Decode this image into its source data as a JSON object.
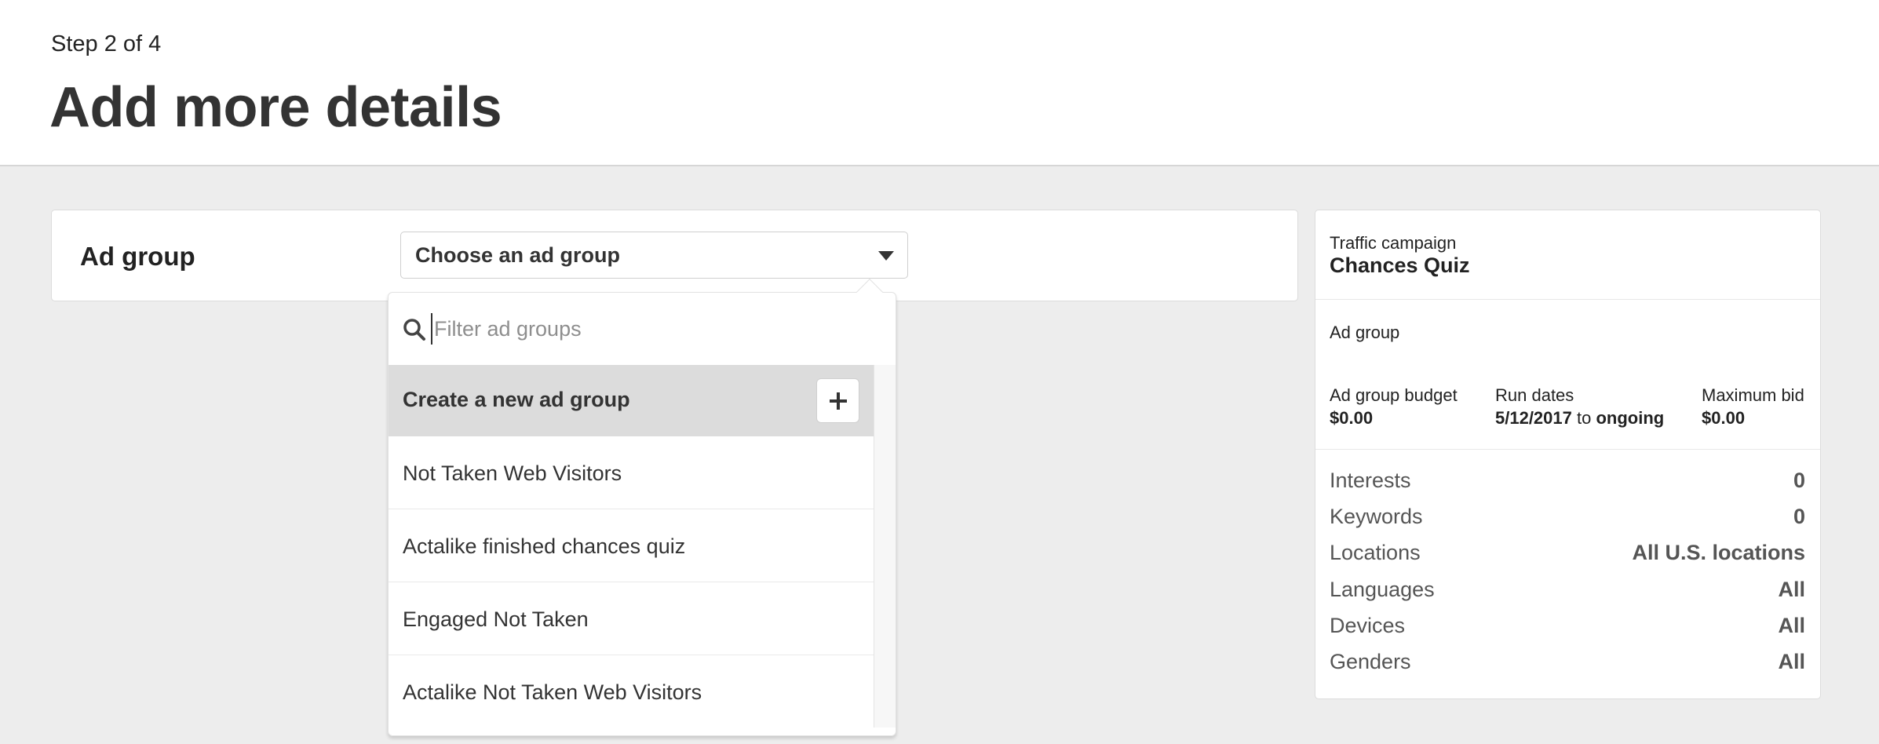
{
  "header": {
    "step": "Step 2 of 4",
    "title": "Add more details"
  },
  "ad_group_field": {
    "label": "Ad group",
    "select_value": "Choose an ad group",
    "caret_icon": "caret-down-icon"
  },
  "dropdown": {
    "filter_placeholder": "Filter ad groups",
    "filter_value": "",
    "search_icon": "search-icon",
    "create_label": "Create a new ad group",
    "create_icon": "plus-icon",
    "items": [
      {
        "label": "Not Taken Web Visitors"
      },
      {
        "label": "Actalike finished chances quiz"
      },
      {
        "label": "Engaged Not Taken"
      },
      {
        "label": "Actalike Not Taken Web Visitors"
      }
    ]
  },
  "summary": {
    "campaign_type": "Traffic campaign",
    "campaign_name": "Chances Quiz",
    "ad_group_label": "Ad group",
    "budget": {
      "label": "Ad group budget",
      "value": "$0.00"
    },
    "run_dates": {
      "label": "Run dates",
      "start": "5/12/2017",
      "connector": " to ",
      "end": "ongoing"
    },
    "max_bid": {
      "label": "Maximum bid",
      "value": "$0.00"
    },
    "targeting": [
      {
        "label": "Interests",
        "value": "0"
      },
      {
        "label": "Keywords",
        "value": "0"
      },
      {
        "label": "Locations",
        "value": "All U.S. locations"
      },
      {
        "label": "Languages",
        "value": "All"
      },
      {
        "label": "Devices",
        "value": "All"
      },
      {
        "label": "Genders",
        "value": "All"
      }
    ]
  },
  "colors": {
    "page_bg": "#ededed",
    "text": "#333333",
    "highlight_row": "#dcdcdc",
    "placeholder": "#8e8e8e"
  }
}
